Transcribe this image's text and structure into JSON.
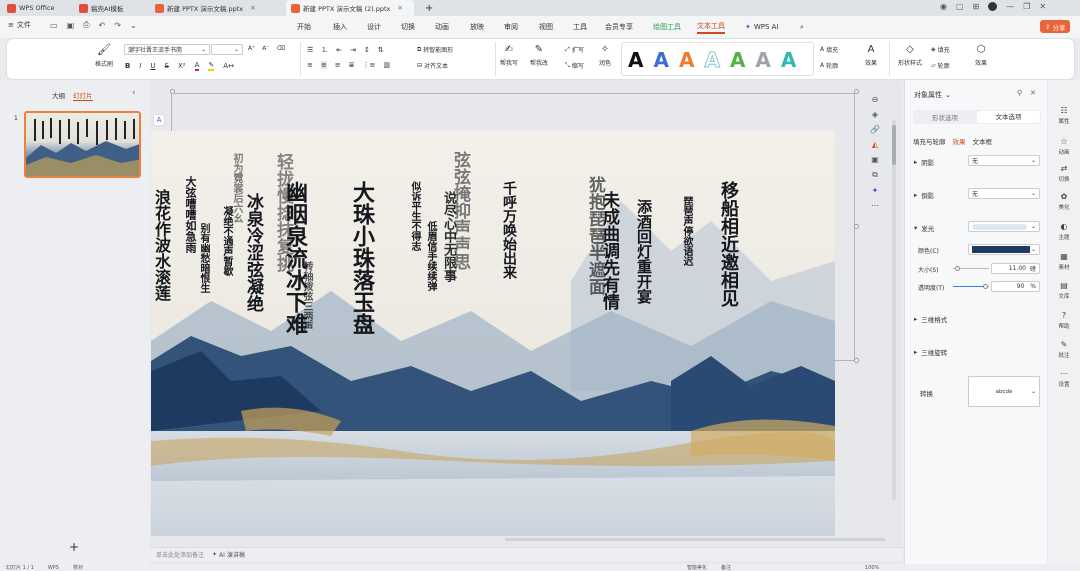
{
  "titlebar": {
    "tabs": [
      {
        "label": "WPS Office",
        "color": "#e34d3c"
      },
      {
        "label": "稿壳AI模板",
        "color": "#e34d3c"
      },
      {
        "label": "新建 PPTX 演示文稿.pptx",
        "color": "#e8643a"
      },
      {
        "label": "新建 PPTX 演示文稿 (2).pptx",
        "color": "#e8643a"
      }
    ],
    "new_tab": "+",
    "share_label": "分享"
  },
  "menubar": {
    "file_label": "文件",
    "items": [
      "开始",
      "插入",
      "设计",
      "切换",
      "动画",
      "放映",
      "审阅",
      "视图",
      "工具",
      "会员专享",
      "绘图工具",
      "文本工具",
      "WPS AI"
    ],
    "active_index": 11,
    "green_index": 10
  },
  "ribbon": {
    "format_painter": "格式刷",
    "font_name": "潮字社晋王流手书简",
    "font_size": "",
    "bold": "B",
    "italic": "I",
    "underline": "U",
    "strike": "S",
    "superscript": "X²",
    "convert_smartart": "转智能图形",
    "align_text": "对齐文本",
    "help_write": "帮我写",
    "help_edit": "帮我改",
    "expand": "扩写",
    "shorten": "缩写",
    "polish": "润色",
    "wordart_letters": [
      "A",
      "A",
      "A",
      "A",
      "A",
      "A",
      "A"
    ],
    "wordart_colors": [
      "#111111",
      "#3b6fd6",
      "#ee7b30",
      "#7fc7cf",
      "#55b04a",
      "#9fa3a8",
      "#35b8b0"
    ],
    "fill_label": "填充",
    "outline_label": "轮廓",
    "effect_label": "效果",
    "shape_style_label": "形状样式",
    "fill2_label": "填充",
    "outline2_label": "轮廓",
    "effect2_label": "效果"
  },
  "leftpanel": {
    "tab_outline": "大纲",
    "tab_slides": "幻灯片",
    "slide_number": "1",
    "add_label": "+"
  },
  "canvas": {
    "notes_placeholder": "单击此处添加备注",
    "ai_notes_label": "AI 演讲稿"
  },
  "poem_columns": [
    "浪花作波水滚莲",
    "大弦嘈嘈如急雨",
    "别有幽愁暗恨生",
    "初为霓裳后六幺",
    "冰泉冷涩弦凝绝",
    "凝绝不通声暂歇",
    "轻拢慢捻抹复挑",
    "幽咽泉流冰下难",
    "转轴拨弦三两声",
    "大珠小珠落玉盘",
    "似诉平生不得志",
    "低眉信手续续弹",
    "说尽心中无限事",
    "弦弦掩抑声声思",
    "千呼万唤始出来",
    "犹抱琵琶半遮面",
    "未成曲调先有情",
    "添酒回灯重开宴",
    "琵琶声停欲语迟",
    "移船相近邀相见"
  ],
  "rightpane": {
    "title": "对象属性",
    "tab_shape": "形状选项",
    "tab_text": "文本选项",
    "sub_fill": "填充与轮廓",
    "sub_effect": "效果",
    "sub_textbox": "文本框",
    "shadow_label": "阴影",
    "shadow_value": "无",
    "reflection_label": "倒影",
    "reflection_value": "无",
    "glow_label": "发光",
    "color_label": "颜色(C)",
    "glow_color": "#1f3a63",
    "size_label": "大小(S)",
    "size_value": "11.00",
    "size_unit": "磅",
    "transparency_label": "透明度(T)",
    "transparency_value": "90",
    "transparency_unit": "%",
    "size_fraction": 0.1,
    "transparency_fraction": 0.9,
    "three_d_format": "三维格式",
    "three_d_rotation": "三维旋转",
    "transform_label": "转换",
    "transform_preview": "abcde"
  },
  "farright": {
    "items": [
      "属性",
      "动画",
      "切换",
      "美化",
      "主题",
      "素材",
      "文库",
      "帮助",
      "批注",
      "设置"
    ]
  },
  "statusbar": {
    "slide_info": "幻灯片 1 / 1",
    "theme": "WPS",
    "mode": "校对",
    "smart_beautify": "智能美化",
    "notes": "备注",
    "zoom": "100%"
  }
}
